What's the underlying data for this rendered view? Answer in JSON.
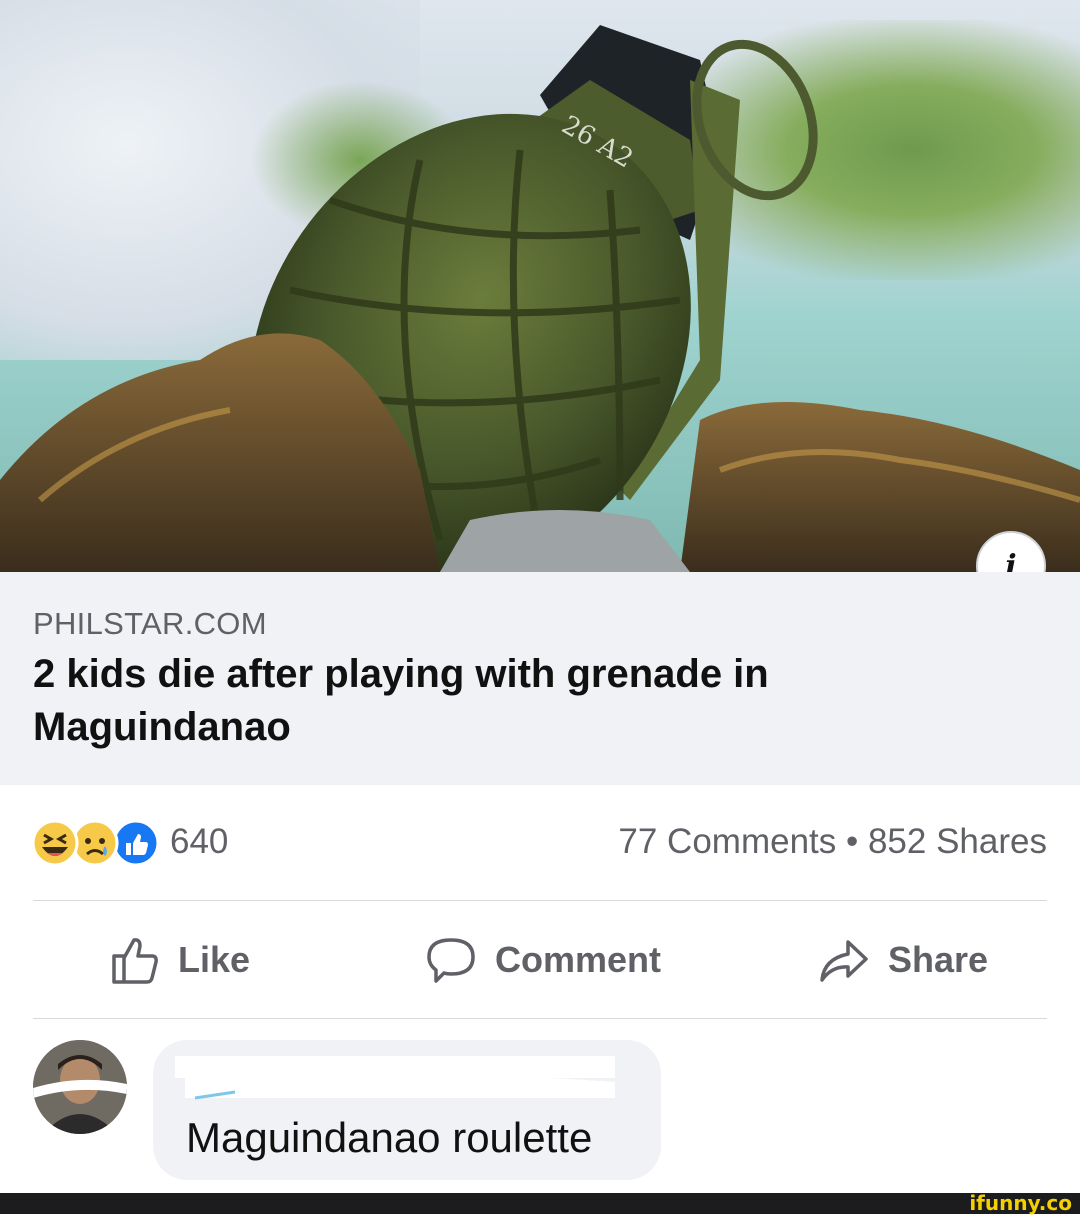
{
  "link_preview": {
    "domain": "PHILSTAR.COM",
    "title": "2 kids die after playing with grenade in Maguindanao",
    "grenade_marking": "26 A2",
    "info_icon": "i"
  },
  "stats": {
    "reactions": [
      "haha-icon",
      "sad-icon",
      "like-icon"
    ],
    "reaction_count": "640",
    "comments_shares": "77 Comments • 852 Shares"
  },
  "actions": {
    "like_label": "Like",
    "comment_label": "Comment",
    "share_label": "Share"
  },
  "comment": {
    "text": "Maguindanao roulette"
  },
  "watermark": "ifunny.co",
  "colors": {
    "card_bg": "#f0f2f5",
    "meta_text": "#5f6166",
    "like_blue": "#1877f2",
    "watermark_yellow": "#f4d000"
  }
}
